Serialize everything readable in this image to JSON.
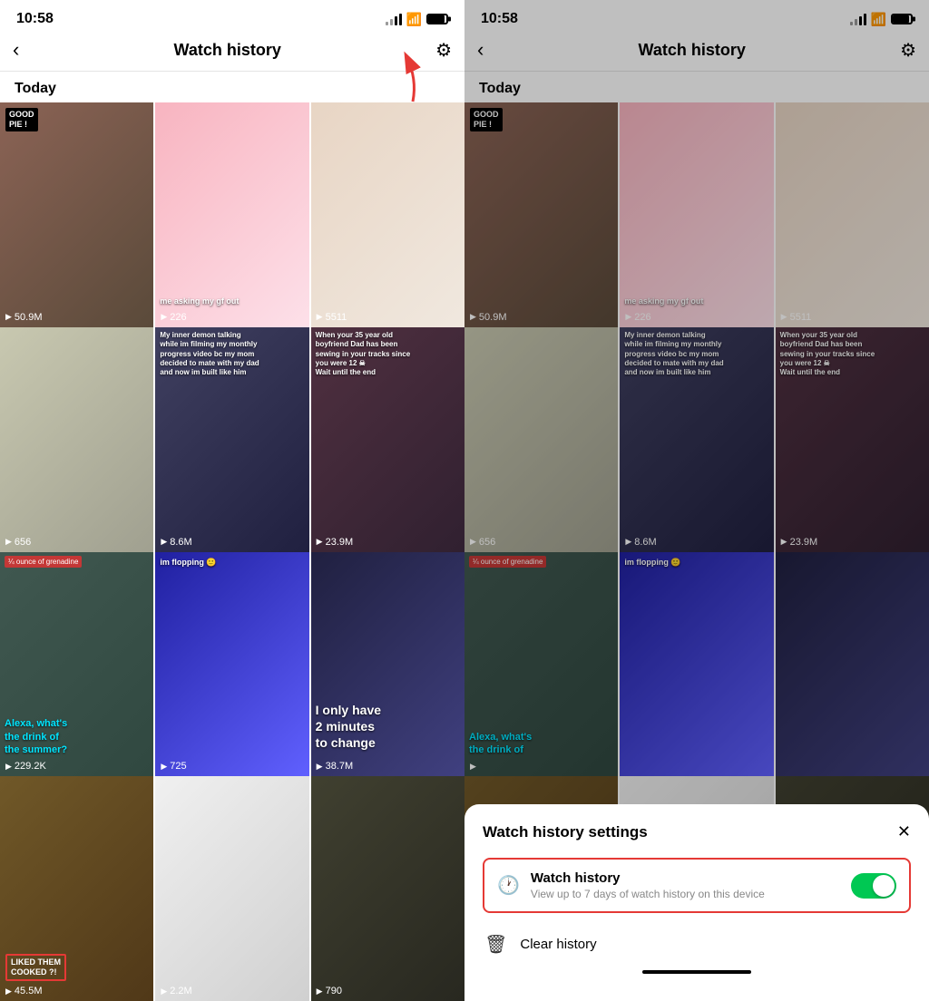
{
  "left_panel": {
    "status": {
      "time": "10:58"
    },
    "nav": {
      "back_label": "‹",
      "title": "Watch history",
      "settings_icon": "⚙"
    },
    "section": "Today",
    "videos": [
      {
        "id": 1,
        "count": "50.9M",
        "label": "GOOD\nPIE !",
        "label_style": "dark",
        "color": "vc1"
      },
      {
        "id": 2,
        "count": "226",
        "overlay": "me asking my gf out",
        "color": "vc2"
      },
      {
        "id": 3,
        "count": "5511",
        "color": "vc3"
      },
      {
        "id": 4,
        "count": "656",
        "color": "vc4"
      },
      {
        "id": 5,
        "count": "8.6M",
        "overlay": "My inner demon talking\nwhile im filming my monthly\nprogress video bc my mom\ndecided to mate with my dad\nand now im built like him",
        "color": "vc5"
      },
      {
        "id": 6,
        "count": "23.9M",
        "overlay": "When your 35 year old\nboyfriend Dad has been\nsewing in your tracks since\nyou were 12 ☠\nWait until the end",
        "color": "vc6"
      },
      {
        "id": 7,
        "count": "229.2K",
        "overlay": "Alexa, what's\nthe drink of\nthe summer?",
        "label": "¼ ounce of grenadine",
        "color": "vc7"
      },
      {
        "id": 8,
        "count": "725",
        "overlay": "im flopping 🙂",
        "color": "vc8"
      },
      {
        "id": 9,
        "count": "38.7M",
        "overlay": "I only have\n2 minutes\nto change",
        "color": "vc9"
      },
      {
        "id": 10,
        "count": "45.5M",
        "label": "LIKED THEM\nCOOKED ?!",
        "color": "vc10"
      },
      {
        "id": 11,
        "count": "2.2M",
        "color": "vc11"
      },
      {
        "id": 12,
        "count": "790",
        "color": "vc12"
      }
    ]
  },
  "right_panel": {
    "status": {
      "time": "10:58"
    },
    "nav": {
      "back_label": "‹",
      "title": "Watch history",
      "settings_icon": "⚙"
    },
    "section": "Today",
    "modal": {
      "title": "Watch history settings",
      "close_label": "✕",
      "watch_history": {
        "label": "Watch history",
        "description": "View up to 7 days of watch history on this device",
        "enabled": true
      },
      "clear_history": {
        "label": "Clear history"
      }
    }
  }
}
